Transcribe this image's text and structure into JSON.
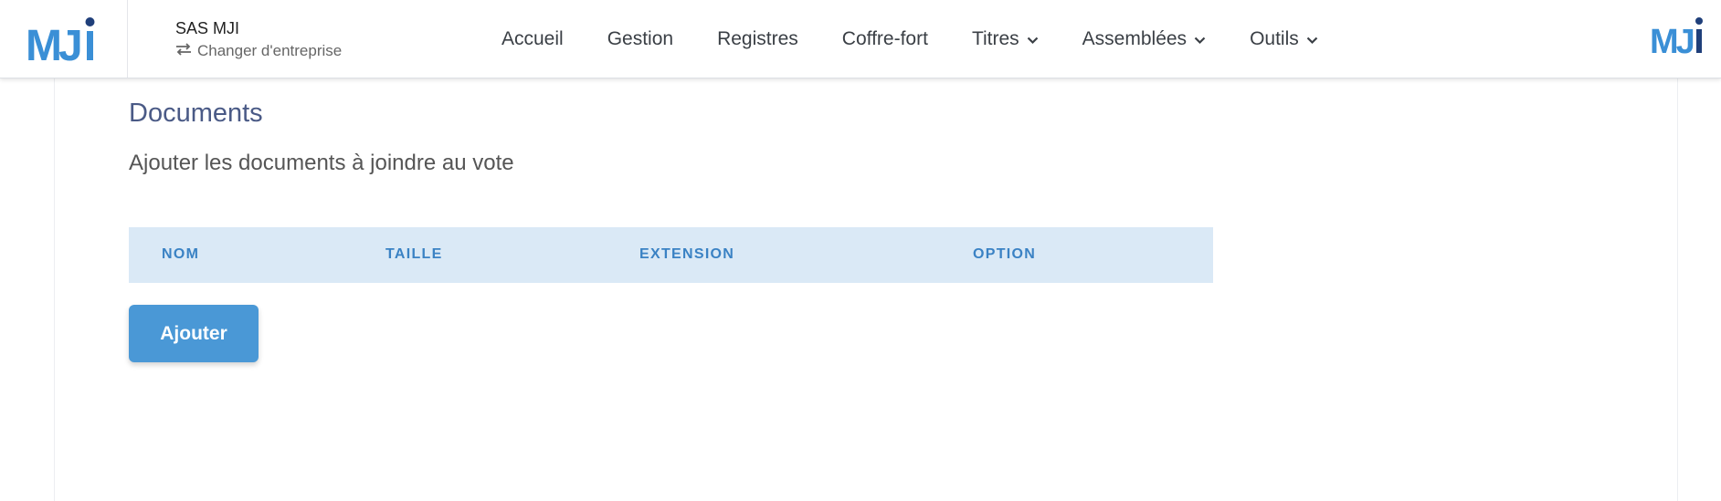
{
  "header": {
    "logo_text": "MJi",
    "company_name": "SAS MJI",
    "switch_company_label": "Changer d'entreprise",
    "brand_color": "#3a8fd6",
    "nav": [
      {
        "label": "Accueil",
        "has_dropdown": false
      },
      {
        "label": "Gestion",
        "has_dropdown": false
      },
      {
        "label": "Registres",
        "has_dropdown": false
      },
      {
        "label": "Coffre-fort",
        "has_dropdown": false
      },
      {
        "label": "Titres",
        "has_dropdown": true
      },
      {
        "label": "Assemblées",
        "has_dropdown": true
      },
      {
        "label": "Outils",
        "has_dropdown": true
      }
    ]
  },
  "documents": {
    "title": "Documents",
    "subtitle": "Ajouter les documents à joindre au vote",
    "table": {
      "columns": [
        "NOM",
        "TAILLE",
        "EXTENSION",
        "OPTION"
      ],
      "rows": []
    },
    "add_button_label": "Ajouter"
  },
  "icons": {
    "switch": "swap-arrows-icon",
    "dropdown": "chevron-down-icon"
  }
}
